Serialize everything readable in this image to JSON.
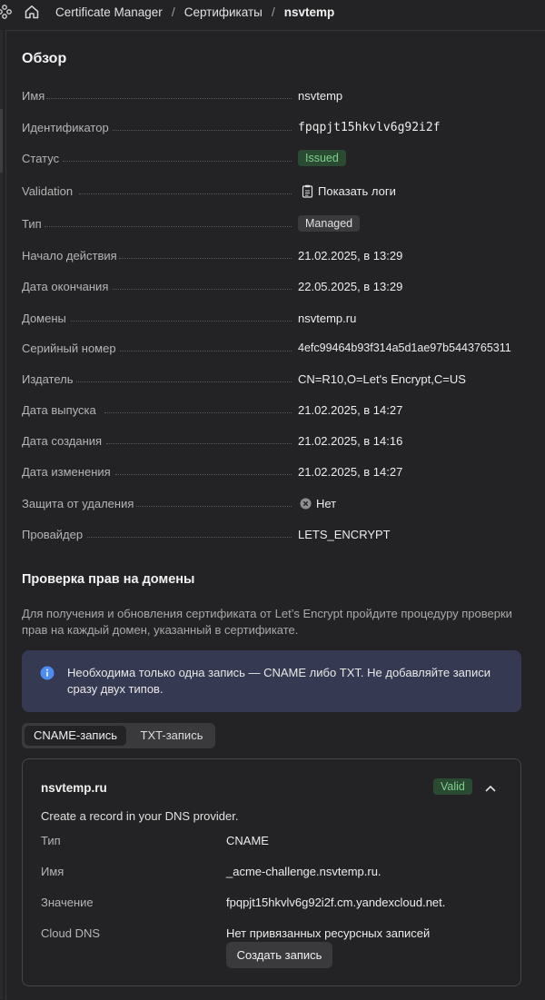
{
  "breadcrumb": {
    "service": "Certificate Manager",
    "section": "Сертификаты",
    "current": "nsvtemp"
  },
  "overview": {
    "title": "Обзор",
    "rows": {
      "name": {
        "label": "Имя",
        "value": "nsvtemp"
      },
      "id": {
        "label": "Идентификатор",
        "value": "fpqpjt15hkvlv6g92i2f"
      },
      "status": {
        "label": "Статус",
        "value": "Issued"
      },
      "validation": {
        "label": "Validation",
        "value": "Показать логи"
      },
      "type": {
        "label": "Тип",
        "value": "Managed"
      },
      "not_before": {
        "label": "Начало действия",
        "value": "21.02.2025, в 13:29"
      },
      "not_after": {
        "label": "Дата окончания",
        "value": "22.05.2025, в 13:29"
      },
      "domains": {
        "label": "Домены",
        "value": "nsvtemp.ru"
      },
      "serial": {
        "label": "Серийный номер",
        "value": "4efc99464b93f314a5d1ae97b5443765311"
      },
      "issuer": {
        "label": "Издатель",
        "value": "CN=R10,O=Let's Encrypt,C=US"
      },
      "issued_at": {
        "label": "Дата выпуска",
        "value": "21.02.2025, в 14:27"
      },
      "created_at": {
        "label": "Дата создания",
        "value": "21.02.2025, в 14:16"
      },
      "updated_at": {
        "label": "Дата изменения",
        "value": "21.02.2025, в 14:27"
      },
      "deletion_protection": {
        "label": "Защита от удаления",
        "value": "Нет"
      },
      "provider": {
        "label": "Провайдер",
        "value": "LETS_ENCRYPT"
      }
    }
  },
  "challenges": {
    "title": "Проверка прав на домены",
    "description": "Для получения и обновления сертификата от Let’s Encrypt пройдите процедуру проверки прав на каждый домен, указанный в сертификате.",
    "info": "Необходима только одна запись — CNAME либо TXT. Не добавляйте записи сразу двух типов.",
    "tabs": [
      "CNAME-запись",
      "TXT-запись"
    ],
    "active_tab": "CNAME-запись",
    "card": {
      "domain": "nsvtemp.ru",
      "status": "Valid",
      "hint": "Create a record in your DNS provider.",
      "type": {
        "label": "Тип",
        "value": "CNAME"
      },
      "name": {
        "label": "Имя",
        "value": "_acme-challenge.nsvtemp.ru."
      },
      "value": {
        "label": "Значение",
        "value": "fpqpjt15hkvlv6g92i2f.cm.yandexcloud.net."
      },
      "cloud_dns": {
        "label": "Cloud DNS",
        "value": "Нет привязанных ресурсных записей"
      },
      "create_button": "Создать запись"
    }
  },
  "colors": {
    "accent_info": "#4d8cf5",
    "valid_green": "#7fd08d"
  },
  "icons": [
    "app-grid-icon",
    "home-icon",
    "log-icon",
    "cross-circle-icon",
    "info-icon",
    "chevron-up-icon"
  ]
}
